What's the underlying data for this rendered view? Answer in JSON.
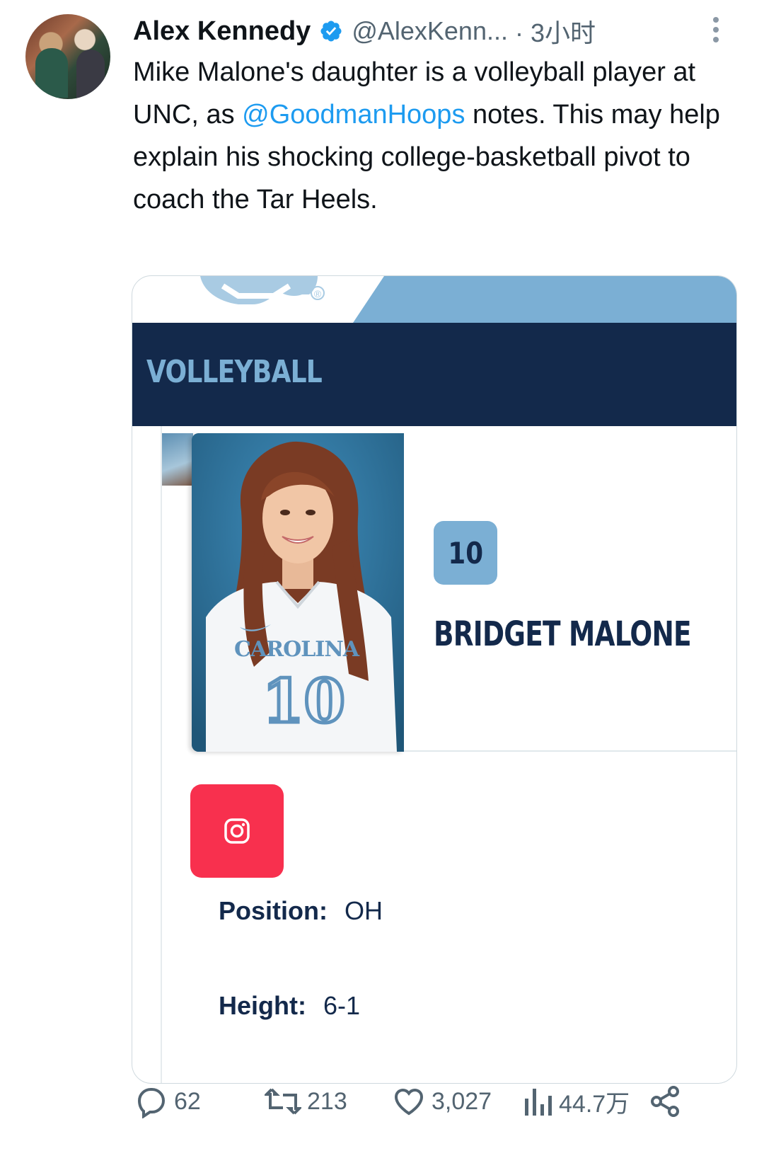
{
  "tweet": {
    "author_name": "Alex Kennedy",
    "handle": "@AlexKenn...",
    "time": "· 3小时",
    "text_parts": {
      "p1": "Mike Malone's daughter is a volleyball player at UNC, as ",
      "mention": "@GoodmanHoops",
      "p2": " notes. This may help explain his shocking college-basketball pivot to coach the Tar Heels."
    }
  },
  "card": {
    "section_title": "VOLLEYBALL",
    "registered_mark": "®",
    "player_number": "10",
    "player_name": "BRIDGET MALONE",
    "jersey_text": "CAROLINA",
    "jersey_number": "10",
    "position_label": "Position:",
    "position_value": "OH",
    "height_label": "Height:",
    "height_value": "6-1"
  },
  "actions": {
    "replies": "62",
    "retweets": "213",
    "likes": "3,027",
    "views": "44.7万"
  },
  "colors": {
    "unc_blue": "#7bafd4",
    "unc_navy": "#13294b",
    "instagram_red": "#f8304e",
    "link_blue": "#1d9bf0",
    "verified_blue": "#1d9bf0"
  },
  "icons": [
    "verified-icon",
    "more-icon",
    "instagram-icon",
    "reply-icon",
    "retweet-icon",
    "like-icon",
    "views-icon",
    "share-icon"
  ]
}
